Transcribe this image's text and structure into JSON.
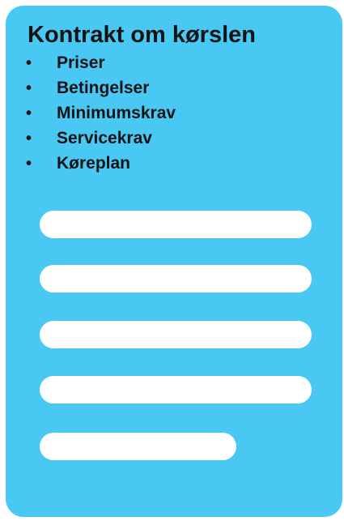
{
  "card": {
    "title": "Kontrakt om kørslen",
    "bullet_symbol": "•",
    "items": [
      {
        "label": "Priser"
      },
      {
        "label": "Betingelser"
      },
      {
        "label": "Minimumskrav"
      },
      {
        "label": "Servicekrav"
      },
      {
        "label": "Køreplan"
      }
    ],
    "placeholder_lines": 5
  },
  "colors": {
    "card_background": "#48c8f3",
    "text": "#141414",
    "placeholder_line": "#ffffff"
  }
}
